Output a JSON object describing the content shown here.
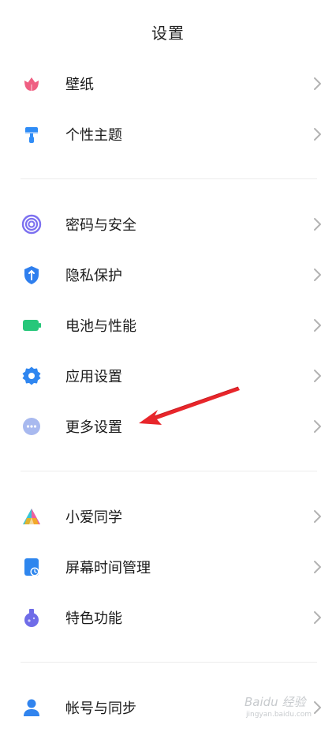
{
  "header": {
    "title": "设置"
  },
  "items": [
    {
      "label": "壁纸",
      "icon": "tulip-icon"
    },
    {
      "label": "个性主题",
      "icon": "paint-roller-icon"
    },
    {
      "label": "密码与安全",
      "icon": "fingerprint-icon"
    },
    {
      "label": "隐私保护",
      "icon": "shield-icon"
    },
    {
      "label": "电池与性能",
      "icon": "battery-icon"
    },
    {
      "label": "应用设置",
      "icon": "gear-icon"
    },
    {
      "label": "更多设置",
      "icon": "more-dots-icon"
    },
    {
      "label": "小爱同学",
      "icon": "xiaoai-icon"
    },
    {
      "label": "屏幕时间管理",
      "icon": "screen-time-icon"
    },
    {
      "label": "特色功能",
      "icon": "potion-icon"
    },
    {
      "label": "帐号与同步",
      "icon": "account-icon"
    }
  ],
  "watermark": {
    "main": "Baidu 经验",
    "sub": "jingyan.baidu.com"
  },
  "colors": {
    "wallpaper": "#ef5f82",
    "theme": "#2f8cf6",
    "security": "#7c70f0",
    "privacy": "#2f7fee",
    "battery": "#27c77a",
    "apps": "#2f86f0",
    "more": "#a8b9ef",
    "screen_time": "#2e86ee",
    "features": "#6f6ce8",
    "account": "#3184ee",
    "arrow": "#e8262b"
  }
}
